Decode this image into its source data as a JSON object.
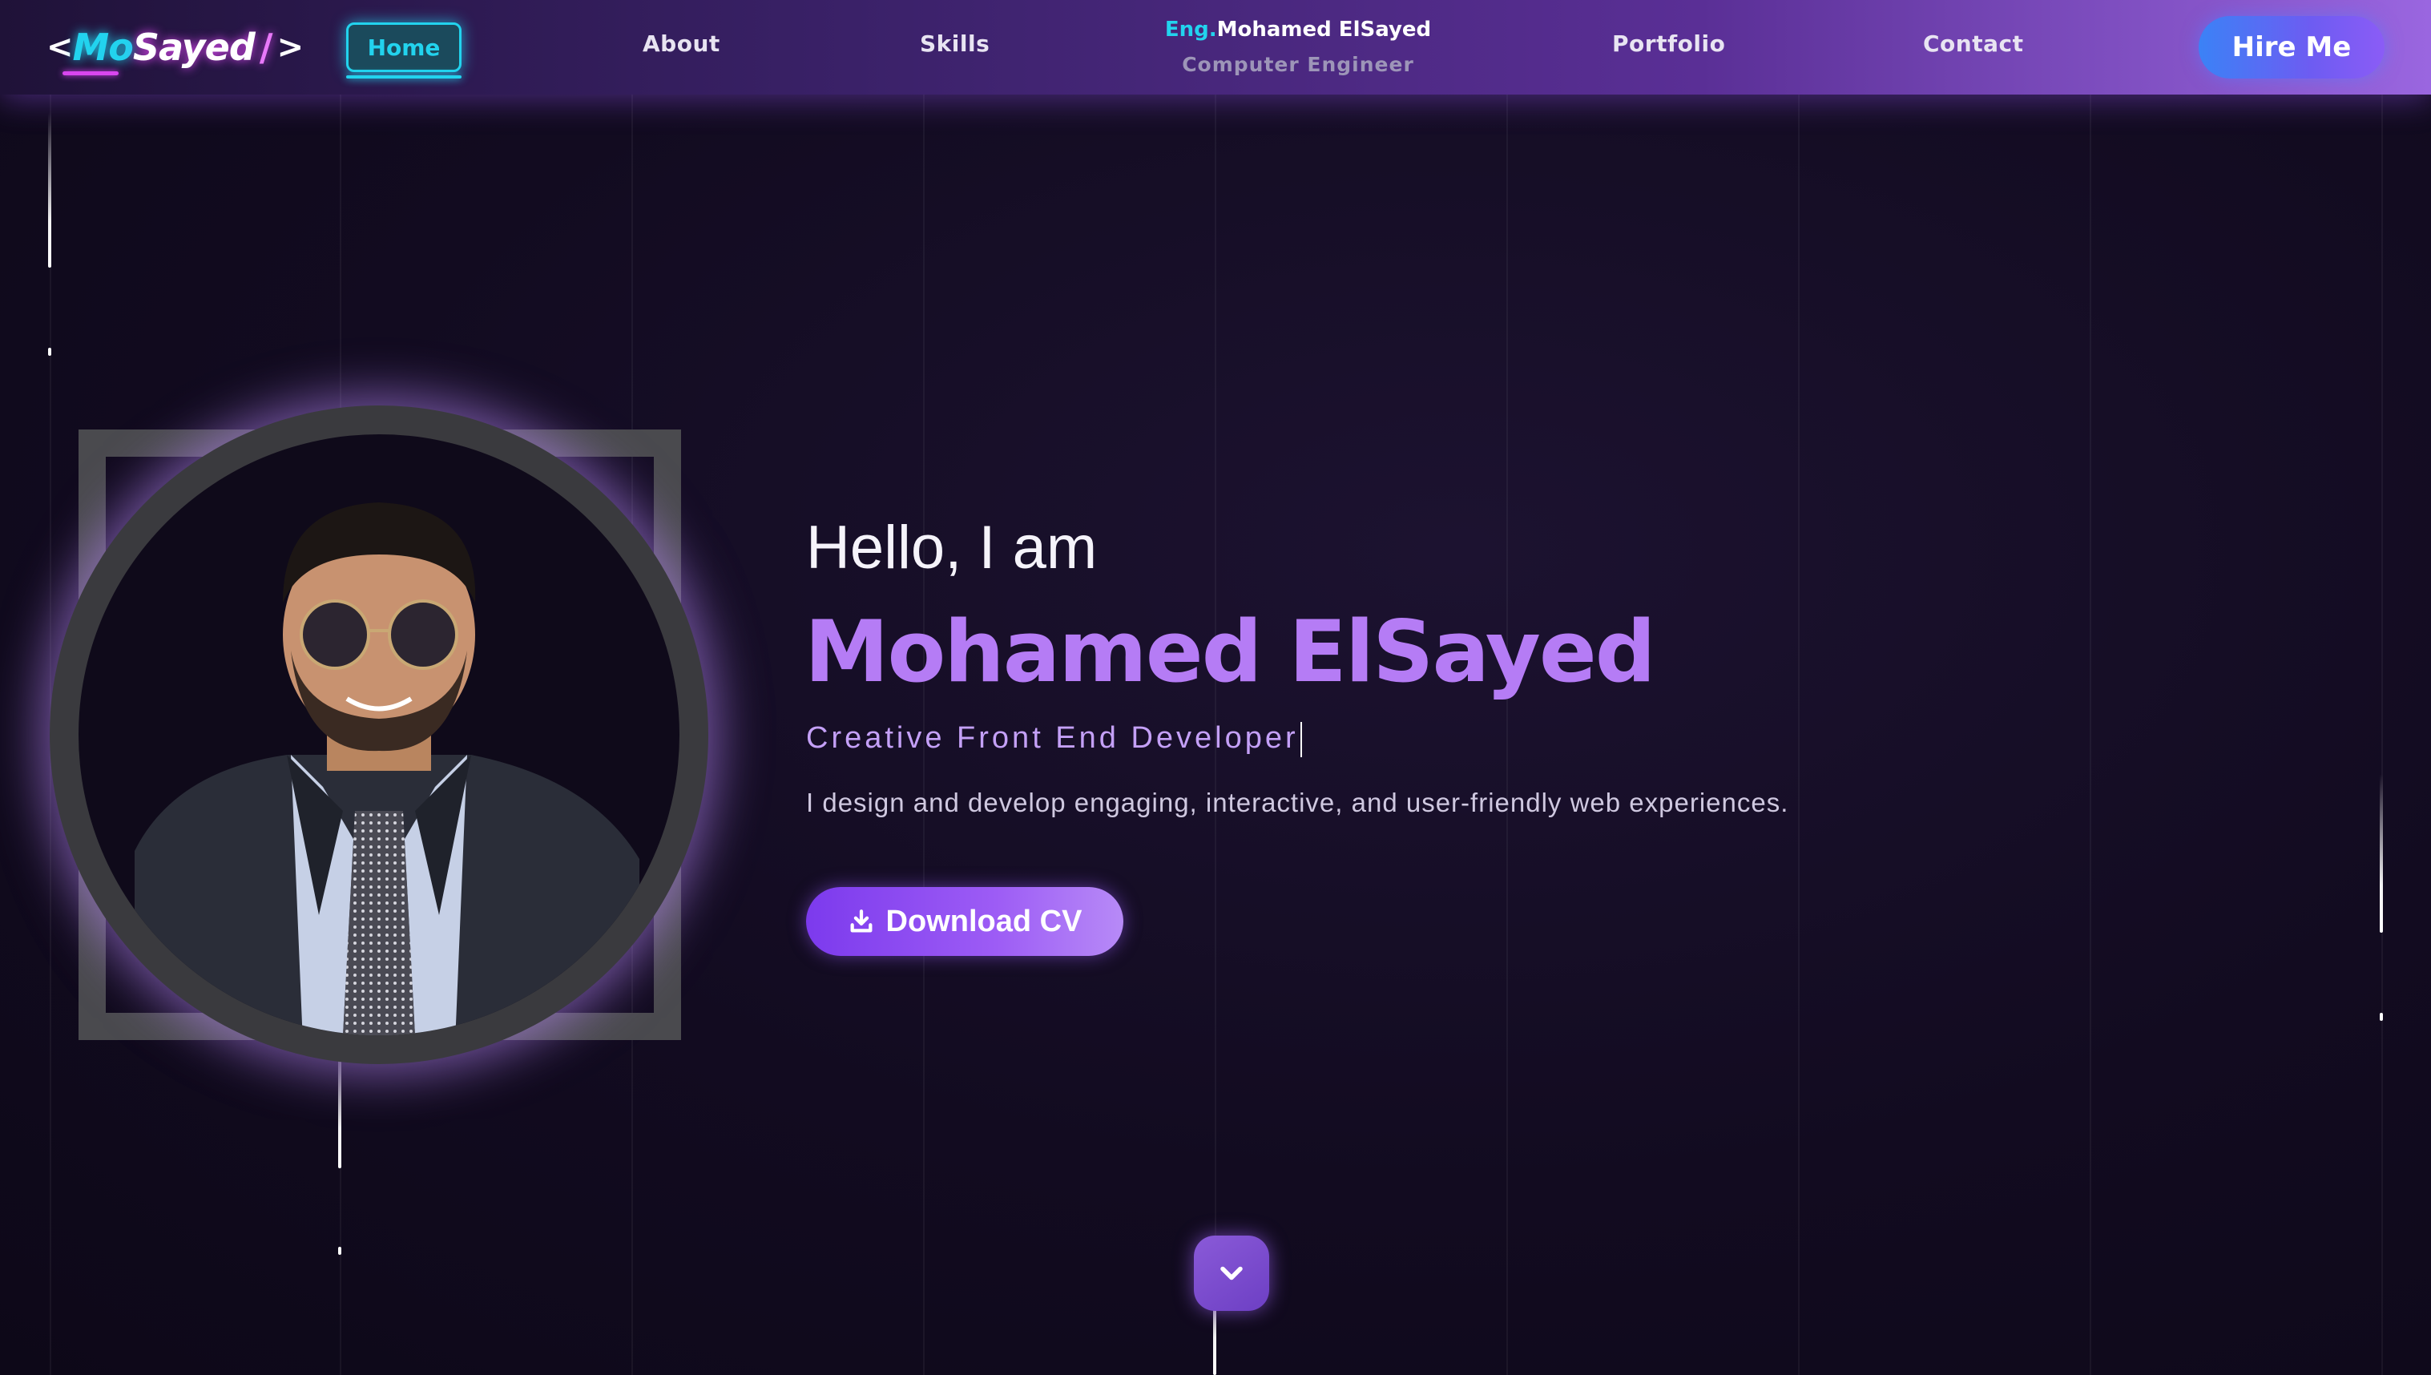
{
  "nav": {
    "logo": {
      "bracket_open": "<",
      "mo": "Mo",
      "sayed": "Sayed",
      "slash": "/",
      "bracket_close": ">"
    },
    "home": "Home",
    "about": "About",
    "skills": "Skills",
    "identity": {
      "prefix": "Eng.",
      "name": "Mohamed ElSayed",
      "title": "Computer Engineer"
    },
    "portfolio": "Portfolio",
    "contact": "Contact",
    "hire_me": "Hire Me"
  },
  "hero": {
    "greeting": "Hello, I am",
    "name": "Mohamed ElSayed",
    "role": "Creative Front End Developer",
    "description": "I design and develop engaging, interactive, and user-friendly web experiences.",
    "cta": "Download CV"
  },
  "icons": {
    "download": "download-icon",
    "scroll": "chevron-down-icon"
  },
  "colors": {
    "accent": "#b57cf5",
    "cyan": "#22d3ee",
    "button": "#7c3aed"
  }
}
